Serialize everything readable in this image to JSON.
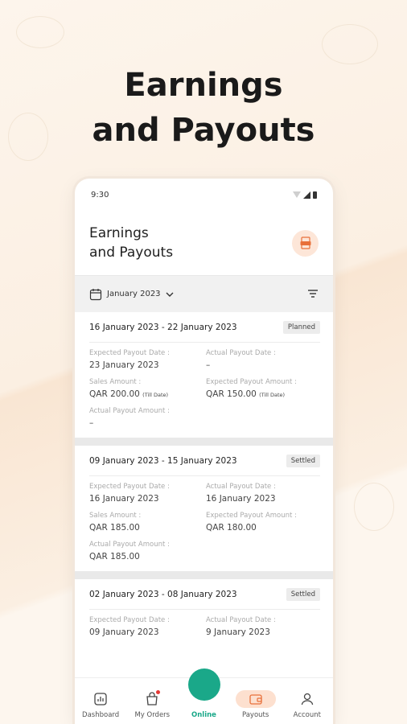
{
  "headline": {
    "line1": "Earnings",
    "line2": "and Payouts"
  },
  "status_bar": {
    "time": "9:30"
  },
  "app_header": {
    "title_line1": "Earnings",
    "title_line2": "and Payouts",
    "pdf_icon": "pdf-icon"
  },
  "filter": {
    "month": "January 2023",
    "filter_icon": "filter-icon"
  },
  "labels": {
    "expected_date": "Expected Payout Date :",
    "actual_date": "Actual Payout Date :",
    "sales_amount": "Sales Amount :",
    "expected_amount": "Expected Payout Amount :",
    "actual_amount": "Actual Payout Amount :",
    "till_date": "(Till Date)"
  },
  "cards": [
    {
      "range": "16 January 2023 - 22 January 2023",
      "status": "Planned",
      "expected_date": "23 January 2023",
      "actual_date": "–",
      "sales_amount": "QAR 200.00",
      "expected_amount": "QAR 150.00",
      "actual_amount": "–"
    },
    {
      "range": "09 January 2023 - 15 January 2023",
      "status": "Settled",
      "expected_date": "16 January 2023",
      "actual_date": "16 January 2023",
      "sales_amount": "QAR 185.00",
      "expected_amount": "QAR 180.00",
      "actual_amount": "QAR 185.00"
    },
    {
      "range": "02 January 2023 - 08 January 2023",
      "status": "Settled",
      "expected_date": "09 January 2023",
      "actual_date": "9 January 2023"
    }
  ],
  "nav": {
    "dashboard": "Dashboard",
    "orders": "My Orders",
    "online": "Online",
    "payouts": "Payouts",
    "account": "Account"
  },
  "colors": {
    "accent": "#1aa889",
    "active_nav_bg": "#fde0cf",
    "badge_red": "#e53935"
  }
}
